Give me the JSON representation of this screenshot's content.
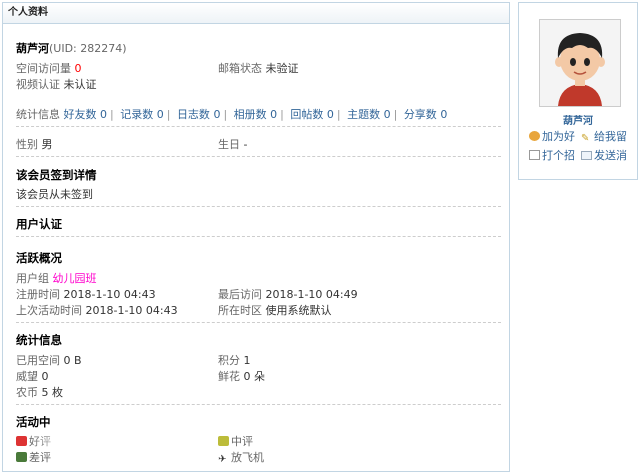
{
  "panel_title": "个人资料",
  "profile": {
    "name": "葫芦河",
    "uid": "(UID: 282274)",
    "visits_label": "空间访问量",
    "visits_value": "0",
    "email_label": "邮箱状态",
    "email_value": "未验证",
    "video_label": "视频认证",
    "video_value": "未认证"
  },
  "stats_line": {
    "label": "统计信息",
    "items": [
      {
        "label": "好友数",
        "value": "0"
      },
      {
        "label": "记录数",
        "value": "0"
      },
      {
        "label": "日志数",
        "value": "0"
      },
      {
        "label": "相册数",
        "value": "0"
      },
      {
        "label": "回帖数",
        "value": "0"
      },
      {
        "label": "主题数",
        "value": "0"
      },
      {
        "label": "分享数",
        "value": "0"
      }
    ]
  },
  "gender": {
    "label": "性别",
    "value": "男"
  },
  "birthday": {
    "label": "生日",
    "value": "-"
  },
  "signin": {
    "title": "该会员签到详情",
    "text": "该会员从未签到"
  },
  "auth": {
    "title": "用户认证"
  },
  "activity": {
    "title": "活跃概况",
    "group_label": "用户组",
    "group_value": "幼儿园班",
    "reg_label": "注册时间",
    "reg_value": "2018-1-10 04:43",
    "last_visit_label": "最后访问",
    "last_visit_value": "2018-1-10 04:49",
    "last_active_label": "上次活动时间",
    "last_active_value": "2018-1-10 04:43",
    "timezone_label": "所在时区",
    "timezone_value": "使用系统默认"
  },
  "statistics": {
    "title": "统计信息",
    "space_label": "已用空间",
    "space_value": "0 B",
    "points_label": "积分",
    "points_value": "1",
    "prestige_label": "威望",
    "prestige_value": "0",
    "flowers_label": "鲜花",
    "flowers_value": "0 朵",
    "coins_label": "农币",
    "coins_value": "5 枚"
  },
  "ratings": {
    "title": "活动中",
    "good": "好评",
    "neutral": "中评",
    "bad": "差评",
    "plane": "放飞机"
  },
  "sidebar": {
    "name": "葫芦河",
    "actions": {
      "add_friend": "加为好",
      "leave_message": "给我留",
      "greet": "打个招",
      "send_message": "发送消"
    }
  },
  "colors": {
    "border": "#c2d5e3",
    "link": "#336699",
    "highlight_red": "#ff0000",
    "group_pink": "#ff00cc"
  }
}
